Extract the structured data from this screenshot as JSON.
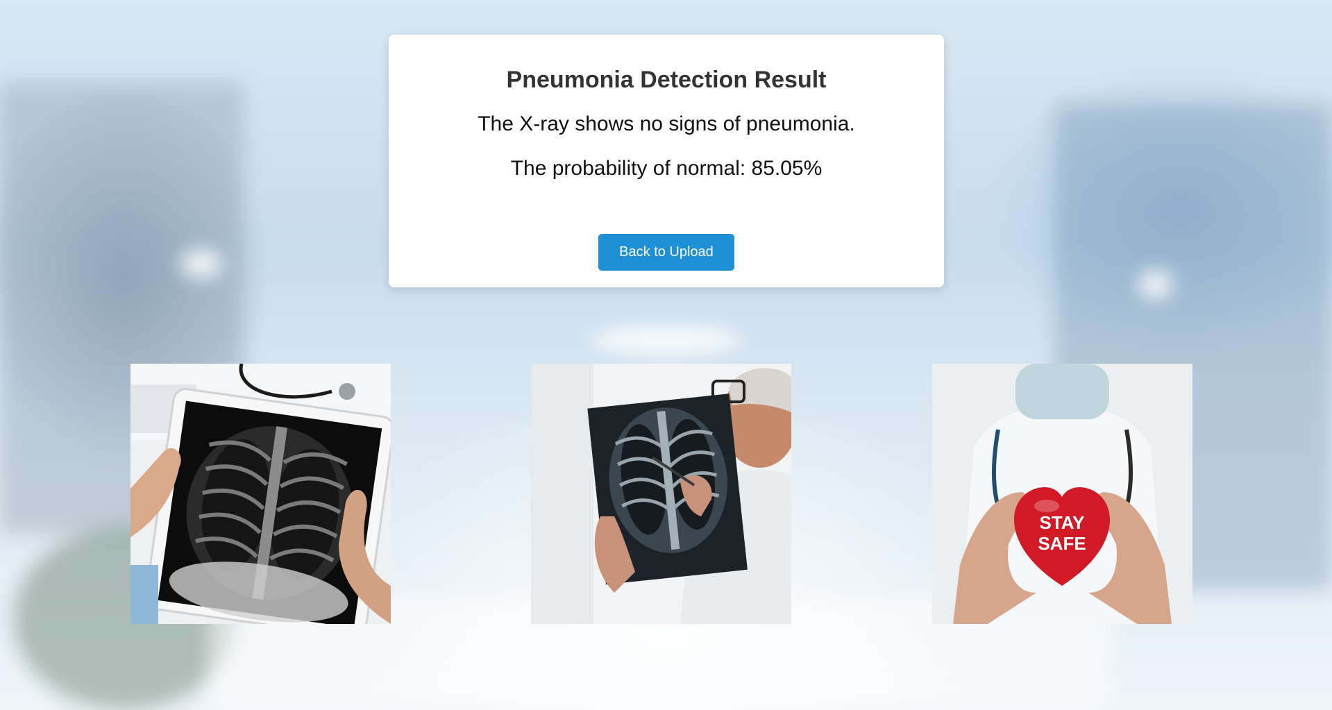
{
  "result": {
    "title": "Pneumonia Detection Result",
    "message": "The X-ray shows no signs of pneumonia.",
    "probability_text": "The probability of normal: 85.05%"
  },
  "actions": {
    "back_label": "Back to Upload"
  },
  "images": [
    {
      "icon": "tablet-xray-image"
    },
    {
      "icon": "doctor-xray-image"
    },
    {
      "icon": "stay-safe-heart-image",
      "heart_text_line1": "STAY",
      "heart_text_line2": "SAFE"
    }
  ],
  "colors": {
    "button": "#1e90d6",
    "heart": "#d11a26",
    "card": "#ffffff"
  }
}
